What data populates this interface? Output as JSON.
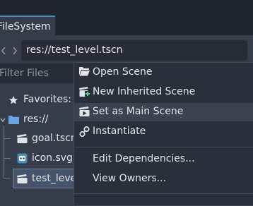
{
  "filesystem": {
    "tab_label": "FileSystem",
    "path": "res://test_level.tscn",
    "filter_placeholder": "Filter Files",
    "tree": {
      "favorites_label": "Favorites:",
      "root_label": "res://",
      "files": [
        {
          "name": "goal.tscn",
          "icon": "scene-clapper-icon"
        },
        {
          "name": "icon.svg",
          "icon": "godot-logo-icon"
        },
        {
          "name": "test_level.tscn",
          "icon": "scene-clapper-icon",
          "selected": true
        }
      ]
    }
  },
  "context_menu": {
    "items": [
      {
        "label": "Open Scene",
        "icon": "folder-open-icon"
      },
      {
        "label": "New Inherited Scene",
        "icon": "inherited-scene-icon"
      },
      {
        "label": "Set as Main Scene",
        "icon": "play-scene-icon",
        "highlighted": true
      },
      {
        "label": "Instantiate",
        "icon": "link-icon"
      },
      {
        "label": "Edit Dependencies...",
        "icon": ""
      },
      {
        "label": "View Owners...",
        "icon": ""
      }
    ]
  },
  "colors": {
    "accent": "#478cbf",
    "panel_bg": "#363d4a",
    "menu_bg": "#2a303b",
    "folder_blue": "#6aa4e6",
    "add_green": "#5fd07f"
  }
}
